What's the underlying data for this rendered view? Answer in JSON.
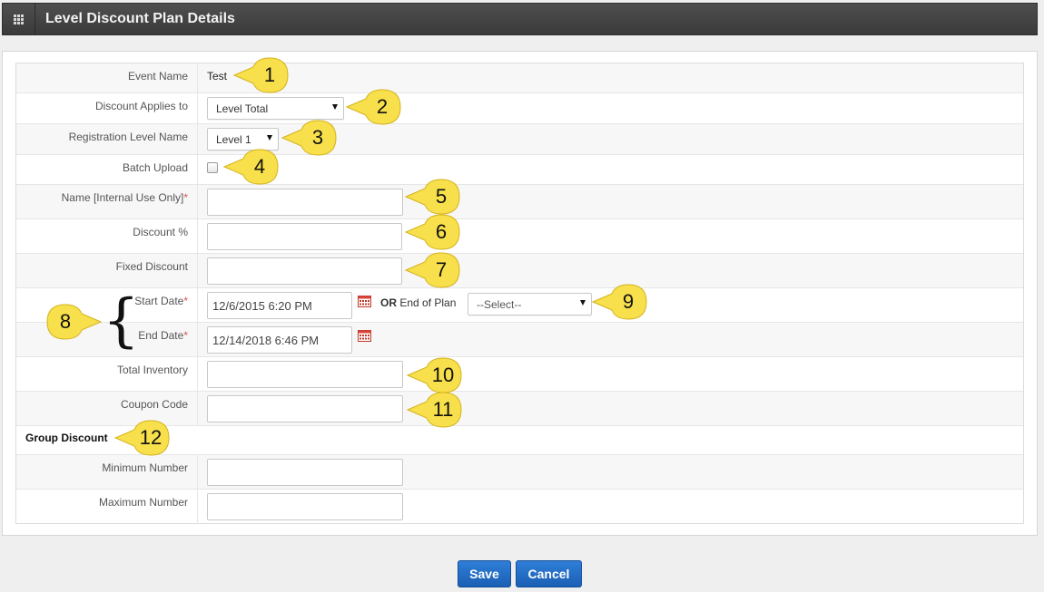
{
  "header": {
    "title": "Level Discount Plan Details",
    "menu_icon": "grid-icon"
  },
  "event_name": {
    "label": "Event Name",
    "value": "Test"
  },
  "discount_applies_to": {
    "label": "Discount Applies to",
    "selected": "Level Total"
  },
  "registration_level": {
    "label": "Registration Level Name",
    "selected": "Level 1"
  },
  "batch_upload": {
    "label": "Batch Upload",
    "checked": false
  },
  "name_internal": {
    "label": "Name [Internal Use Only]",
    "required_mark": "*",
    "value": ""
  },
  "discount_percent": {
    "label": "Discount %",
    "value": ""
  },
  "fixed_discount": {
    "label": "Fixed Discount",
    "value": ""
  },
  "start_date": {
    "label": "Start Date",
    "required_mark": "*",
    "value": "12/6/2015 6:20 PM",
    "icon": "calendar-icon"
  },
  "end_of_plan": {
    "or_text": "OR",
    "label": "End of Plan",
    "selected": "--Select--"
  },
  "end_date": {
    "label": "End Date",
    "required_mark": "*",
    "value": "12/14/2018 6:46 PM",
    "icon": "calendar-icon"
  },
  "total_inventory": {
    "label": "Total Inventory",
    "value": ""
  },
  "coupon_code": {
    "label": "Coupon Code",
    "value": ""
  },
  "group_discount": {
    "title": "Group Discount"
  },
  "minimum_number": {
    "label": "Minimum Number",
    "value": ""
  },
  "maximum_number": {
    "label": "Maximum Number",
    "value": ""
  },
  "annotations": {
    "c1": "1",
    "c2": "2",
    "c3": "3",
    "c4": "4",
    "c5": "5",
    "c6": "6",
    "c7": "7",
    "c8": "8",
    "c9": "9",
    "c10": "10",
    "c11": "11",
    "c12": "12",
    "brace": "{",
    "callout_color": "#f7e04b"
  },
  "buttons": {
    "save": "Save",
    "cancel": "Cancel",
    "color": "#1f66c1"
  }
}
